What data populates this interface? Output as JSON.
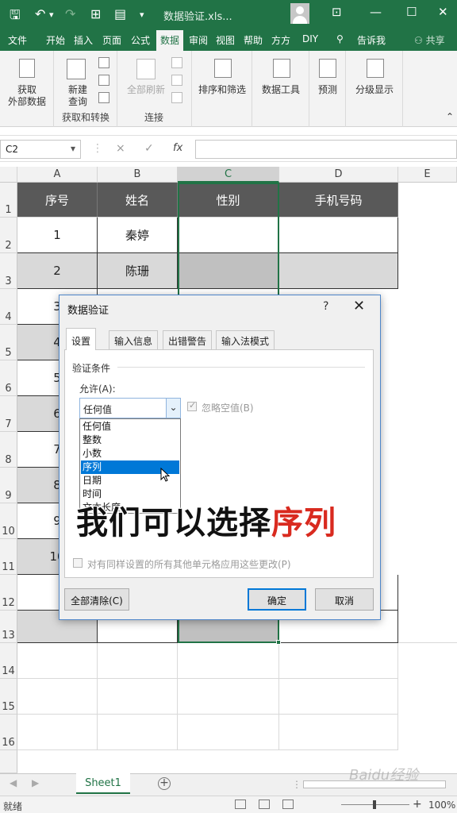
{
  "titlebar": {
    "filename": "数据验证.xls...",
    "qa_dropdown": "▾"
  },
  "tabs": [
    "文件",
    "开始",
    "插入",
    "页面",
    "公式",
    "数据",
    "审阅",
    "视图",
    "帮助",
    "方方",
    "DIY",
    "告诉我"
  ],
  "active_tab": "数据",
  "share_label": "共享",
  "ribbon": {
    "get_external": "获取\n外部数据",
    "get_external_l1": "获取",
    "get_external_l2": "外部数据",
    "new_query_l1": "新建",
    "new_query_l2": "查询",
    "group_get_transform": "获取和转换",
    "refresh_all": "全部刷新",
    "group_connections": "连接",
    "sort_filter": "排序和筛选",
    "data_tools": "数据工具",
    "forecast": "预测",
    "outline": "分级显示"
  },
  "formula_bar": {
    "name_box": "C2",
    "cancel_icon": "×",
    "enter_icon": "✓",
    "fx_label": "fx",
    "formula": ""
  },
  "grid": {
    "columns": [
      "A",
      "B",
      "C",
      "D",
      "E"
    ],
    "rows": [
      "1",
      "2",
      "3",
      "4",
      "5",
      "6",
      "7",
      "8",
      "9",
      "10",
      "11",
      "12",
      "13",
      "14",
      "15",
      "16"
    ],
    "headers": [
      "序号",
      "姓名",
      "性别",
      "手机号码"
    ],
    "data": [
      [
        "1",
        "秦婷",
        "",
        ""
      ],
      [
        "2",
        "陈珊",
        "",
        ""
      ]
    ],
    "partial_col_a": [
      "3",
      "4",
      "5",
      "6",
      "7",
      "8",
      "9",
      "10"
    ]
  },
  "sheet": {
    "tab_label": "Sheet1",
    "add_icon": "+"
  },
  "status": {
    "ready": "就绪",
    "zoom": "100%"
  },
  "dialog": {
    "title": "数据验证",
    "help": "?",
    "close": "✕",
    "tabs": [
      "设置",
      "输入信息",
      "出错警告",
      "输入法模式"
    ],
    "section_label": "验证条件",
    "allow_label": "允许(A):",
    "allow_value": "任何值",
    "ignore_blank": "忽略空值(B)",
    "options": [
      "任何值",
      "整数",
      "小数",
      "序列",
      "日期",
      "时间",
      "文本长度"
    ],
    "highlighted_option": "序列",
    "apply_all": "对有同样设置的所有其他单元格应用这些更改(P)",
    "clear_all": "全部清除(C)",
    "ok": "确定",
    "cancel": "取消"
  },
  "caption": {
    "prefix": "我们可以选择",
    "highlight": "序列"
  },
  "watermark": "Baidu经验"
}
